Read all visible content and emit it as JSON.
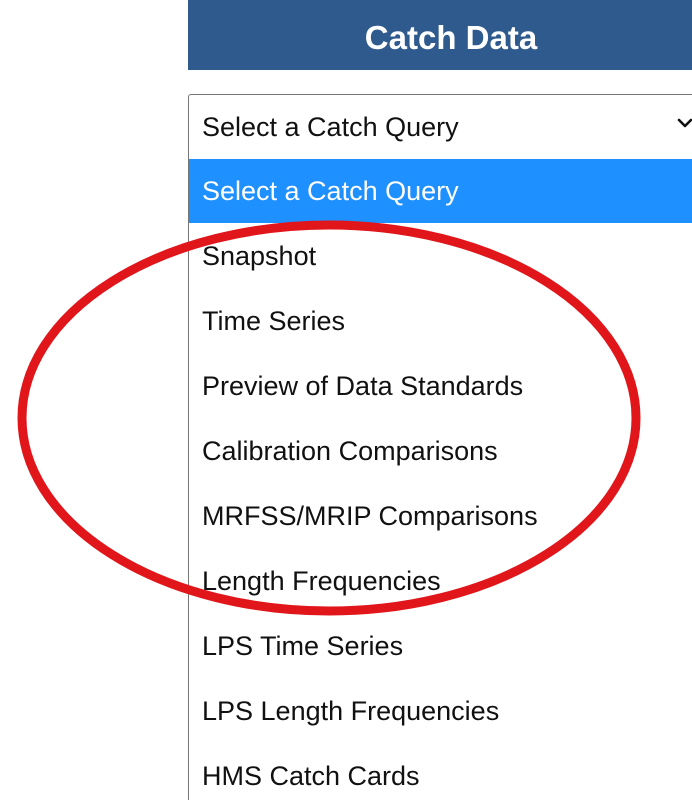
{
  "header": {
    "title": "Catch Data"
  },
  "select": {
    "value": "Select a Catch Query",
    "chevron_icon": "chevron-down-icon"
  },
  "dropdown": {
    "options": [
      {
        "label": "Select a Catch Query",
        "selected": true
      },
      {
        "label": "Snapshot",
        "selected": false
      },
      {
        "label": "Time Series",
        "selected": false
      },
      {
        "label": "Preview of Data Standards",
        "selected": false
      },
      {
        "label": "Calibration Comparisons",
        "selected": false
      },
      {
        "label": "MRFSS/MRIP Comparisons",
        "selected": false
      },
      {
        "label": "Length Frequencies",
        "selected": false
      },
      {
        "label": "LPS Time Series",
        "selected": false
      },
      {
        "label": "LPS Length Frequencies",
        "selected": false
      },
      {
        "label": "HMS Catch Cards",
        "selected": false
      }
    ]
  },
  "colors": {
    "header_bg": "#2e5a8e",
    "selected_bg": "#1e90ff",
    "annotation_red": "#e0161b"
  }
}
